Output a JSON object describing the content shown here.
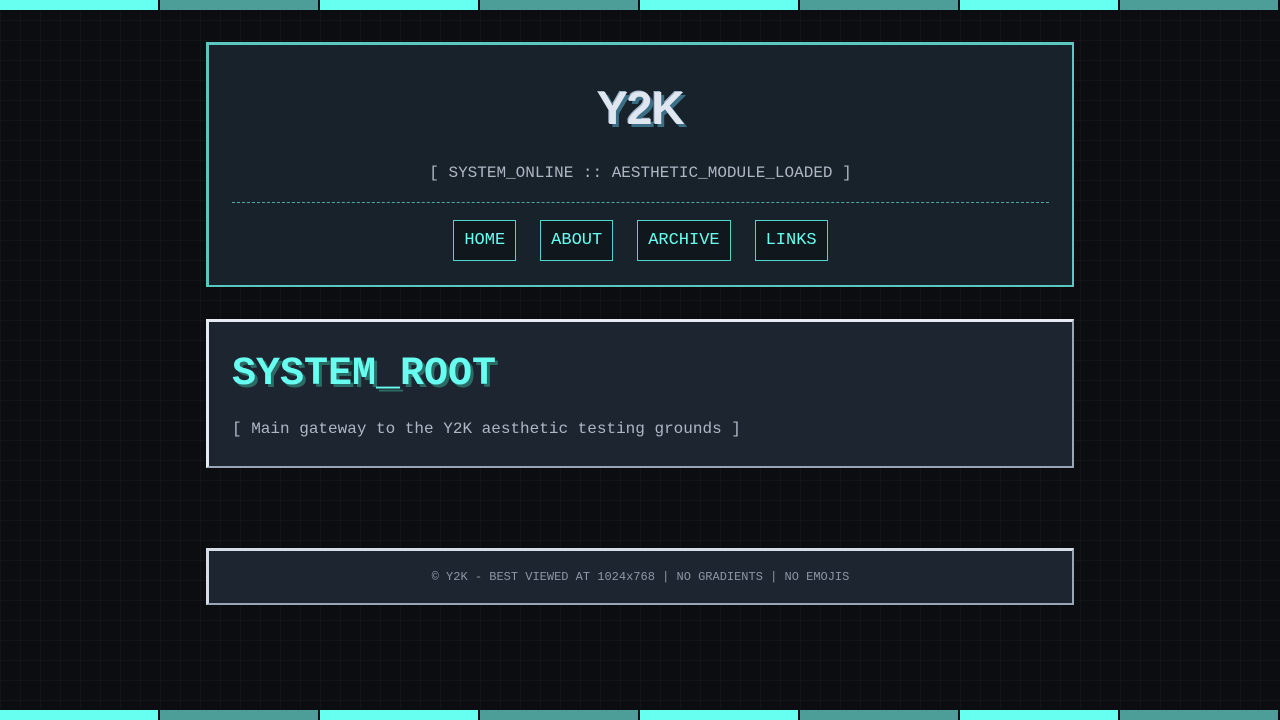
{
  "colors": {
    "background": "#0b0d11",
    "accent_cyan": "#66fff0",
    "accent_teal": "#4d9e98",
    "panel": "#18222b",
    "text_muted": "#aeb6c3"
  },
  "header": {
    "logo": "Y2K",
    "tagline": "[ SYSTEM_ONLINE :: AESTHETIC_MODULE_LOADED ]",
    "nav": [
      {
        "label": "HOME"
      },
      {
        "label": "ABOUT"
      },
      {
        "label": "ARCHIVE"
      },
      {
        "label": "LINKS"
      }
    ]
  },
  "main": {
    "title": "SYSTEM_ROOT",
    "description": "[ Main gateway to the Y2K aesthetic testing grounds ]"
  },
  "footer": {
    "text": "© Y2K - BEST VIEWED AT 1024x768 | NO GRADIENTS | NO EMOJIS"
  }
}
